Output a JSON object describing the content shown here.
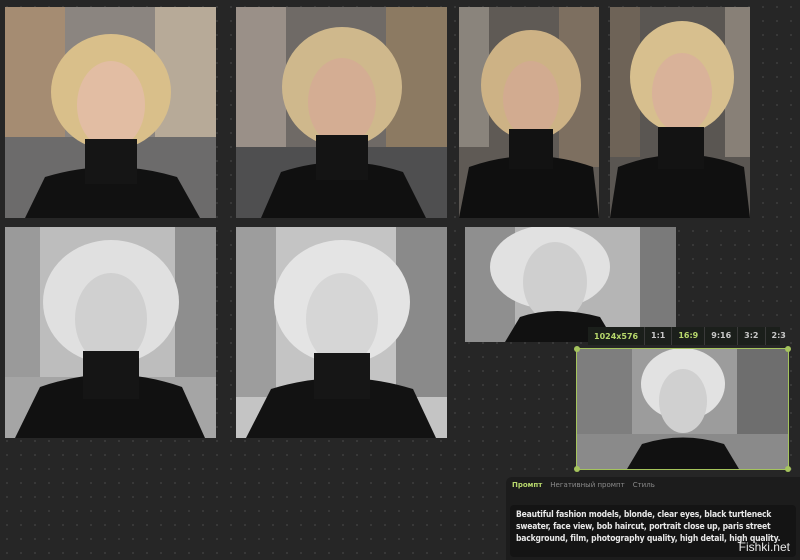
{
  "ratio_bar": {
    "resolution": "1024x576",
    "options": [
      "1:1",
      "16:9",
      "9:16",
      "3:2",
      "2:3"
    ],
    "active": "16:9"
  },
  "prompt_panel": {
    "tabs": [
      "Промпт",
      "Негативный промпт",
      "Стиль"
    ],
    "active_tab": "Промпт",
    "text": "Beautiful fashion models, blonde, clear eyes, black turtleneck sweater, face view, bob haircut, portrait close up, paris street background, film, photography quality, high detail, high quality."
  },
  "watermark": "Fishki.net",
  "colors": {
    "accent": "#a5c45d",
    "canvas": "#262626"
  }
}
